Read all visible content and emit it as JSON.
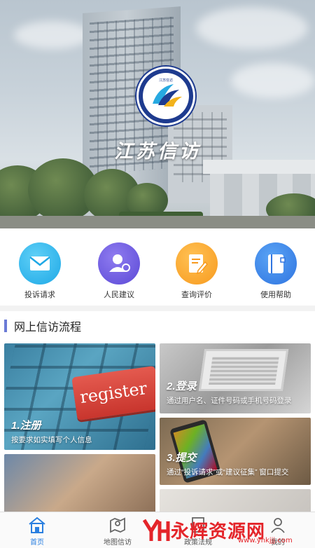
{
  "hero": {
    "title": "江苏信访",
    "logo_text": "JIANG SU XIN FANG",
    "logo_colors": [
      "#1e3b8f",
      "#27a9e1",
      "#f2b21b"
    ]
  },
  "actions": [
    {
      "label": "投诉请求",
      "icon": "mail-icon",
      "color": "#1ea8e6"
    },
    {
      "label": "人民建议",
      "icon": "person-icon",
      "color": "#5b49d6"
    },
    {
      "label": "查询评价",
      "icon": "edit-document-icon",
      "color": "#f79a1e"
    },
    {
      "label": "使用帮助",
      "icon": "help-book-icon",
      "color": "#2f74e0"
    }
  ],
  "section": {
    "title": "网上信访流程"
  },
  "process": [
    {
      "heading": "1.注册",
      "desc": "按要求如实填写个人信息",
      "image_text": "register"
    },
    {
      "heading": "2.登录",
      "desc": "通过用户名、证件号码或手机号码登录"
    },
    {
      "heading": "3.提交",
      "desc": "通过“投诉请求”或“建议征集” 窗口提交"
    }
  ],
  "bottom_nav": [
    {
      "label": "首页",
      "icon": "home-icon",
      "active": true
    },
    {
      "label": "地图信访",
      "icon": "map-pin-icon",
      "active": false
    },
    {
      "label": "政策法规",
      "icon": "policy-icon",
      "active": false
    },
    {
      "label": "我的",
      "icon": "user-icon",
      "active": false
    }
  ],
  "watermark": {
    "brand": "永辉资源网",
    "url": "www.yhkjjj.com"
  },
  "colors": {
    "accent": "#2a7fe0",
    "section_bar": "#6b7bd6"
  }
}
